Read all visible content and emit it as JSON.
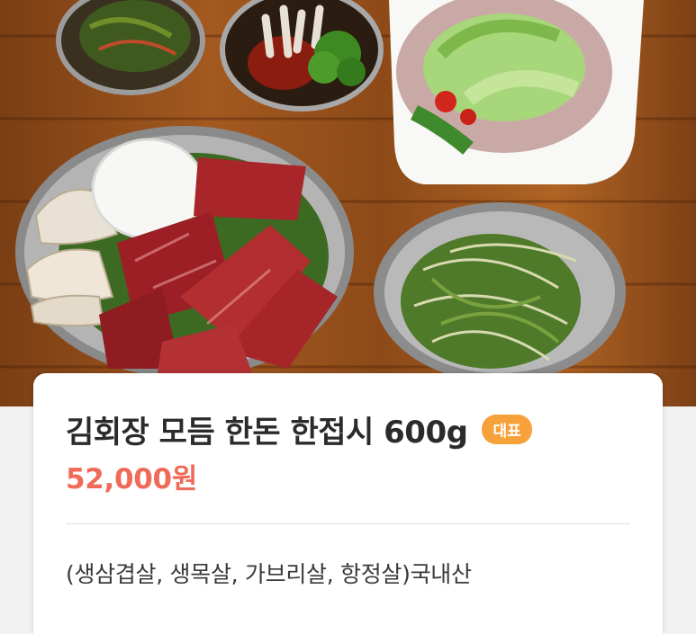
{
  "product": {
    "title": "김회장 모듬 한돈 한접시 600g",
    "badge": "대표",
    "price": "52,000원",
    "description": "(생삼겹살, 생목살, 가브리살, 항정살)국내산"
  },
  "colors": {
    "price": "#f06a5a",
    "badge": "#f6a13a",
    "title": "#2b2b2b"
  }
}
